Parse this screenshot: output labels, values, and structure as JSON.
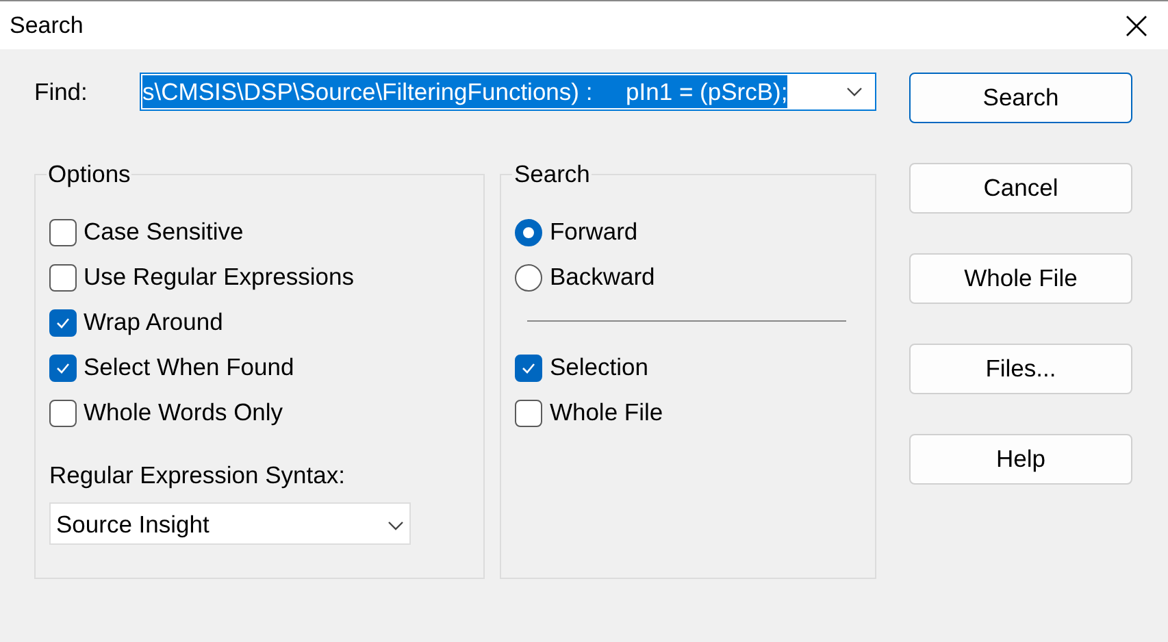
{
  "window": {
    "title": "Search"
  },
  "find": {
    "label": "Find:",
    "value": "s\\CMSIS\\DSP\\Source\\FilteringFunctions) :     pIn1 = (pSrcB);",
    "highlighted": true
  },
  "options": {
    "title": "Options",
    "items": [
      {
        "label": "Case Sensitive",
        "checked": false
      },
      {
        "label": "Use Regular Expressions",
        "checked": false
      },
      {
        "label": "Wrap Around",
        "checked": true
      },
      {
        "label": "Select When Found",
        "checked": true
      },
      {
        "label": "Whole Words Only",
        "checked": false
      }
    ],
    "syntax_label": "Regular Expression Syntax:",
    "syntax_value": "Source Insight"
  },
  "search": {
    "title": "Search",
    "direction": [
      {
        "label": "Forward",
        "selected": true
      },
      {
        "label": "Backward",
        "selected": false
      }
    ],
    "scope": [
      {
        "label": "Selection",
        "checked": true
      },
      {
        "label": "Whole File",
        "checked": false
      }
    ]
  },
  "buttons": [
    {
      "label": "Search",
      "default": true
    },
    {
      "label": "Cancel",
      "default": false
    },
    {
      "label": "Whole File",
      "default": false
    },
    {
      "label": "Files...",
      "default": false
    },
    {
      "label": "Help",
      "default": false
    }
  ]
}
